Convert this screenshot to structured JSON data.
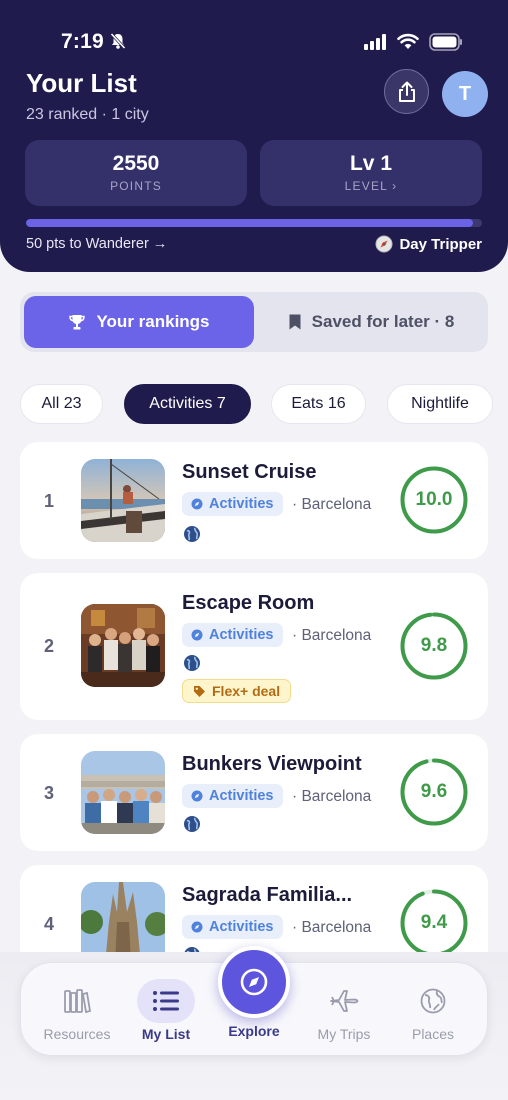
{
  "status_bar": {
    "time": "7:19"
  },
  "header": {
    "title": "Your List",
    "subtitle": "23 ranked · 1 city",
    "avatar_initial": "T",
    "points_value": "2550",
    "points_label": "POINTS",
    "level_value": "Lv 1",
    "level_label": "LEVEL ›",
    "progress_fraction": 0.98,
    "next_tier": "50 pts to Wanderer →",
    "current_tier": "Day Tripper"
  },
  "segment": {
    "rankings_label": "Your rankings",
    "saved_label": "Saved for later · 8"
  },
  "filters": [
    "All 23",
    "Activities 7",
    "Eats 16",
    "Nightlife"
  ],
  "active_filter": "Activities 7",
  "items": [
    {
      "rank": "1",
      "name": "Sunset Cruise",
      "category": "Activities",
      "city": "· Barcelona",
      "score": "10.0",
      "score_fraction": 1.0,
      "deal": ""
    },
    {
      "rank": "2",
      "name": "Escape Room",
      "category": "Activities",
      "city": "· Barcelona",
      "score": "9.8",
      "score_fraction": 0.98,
      "deal": "Flex+ deal"
    },
    {
      "rank": "3",
      "name": "Bunkers Viewpoint",
      "category": "Activities",
      "city": "· Barcelona",
      "score": "9.6",
      "score_fraction": 0.96,
      "deal": ""
    },
    {
      "rank": "4",
      "name": "Sagrada Familia...",
      "category": "Activities",
      "city": "· Barcelona",
      "score": "9.4",
      "score_fraction": 0.94,
      "deal": ""
    }
  ],
  "nav": {
    "resources": "Resources",
    "my_list": "My List",
    "explore": "Explore",
    "my_trips": "My Trips",
    "places": "Places"
  },
  "colors": {
    "header_bg": "#1f1b4d",
    "accent": "#6b63e8",
    "score_green": "#3f9a4a",
    "tag_blue": "#4f82dc"
  },
  "icons": [
    "bell-off-icon",
    "signal-icon",
    "wifi-icon",
    "battery-icon",
    "share-icon",
    "compass-icon",
    "trophy-icon",
    "bookmark-icon",
    "compass-tag-icon",
    "globe-icon",
    "tag-icon",
    "books-icon",
    "list-icon",
    "plane-icon",
    "world-icon"
  ]
}
